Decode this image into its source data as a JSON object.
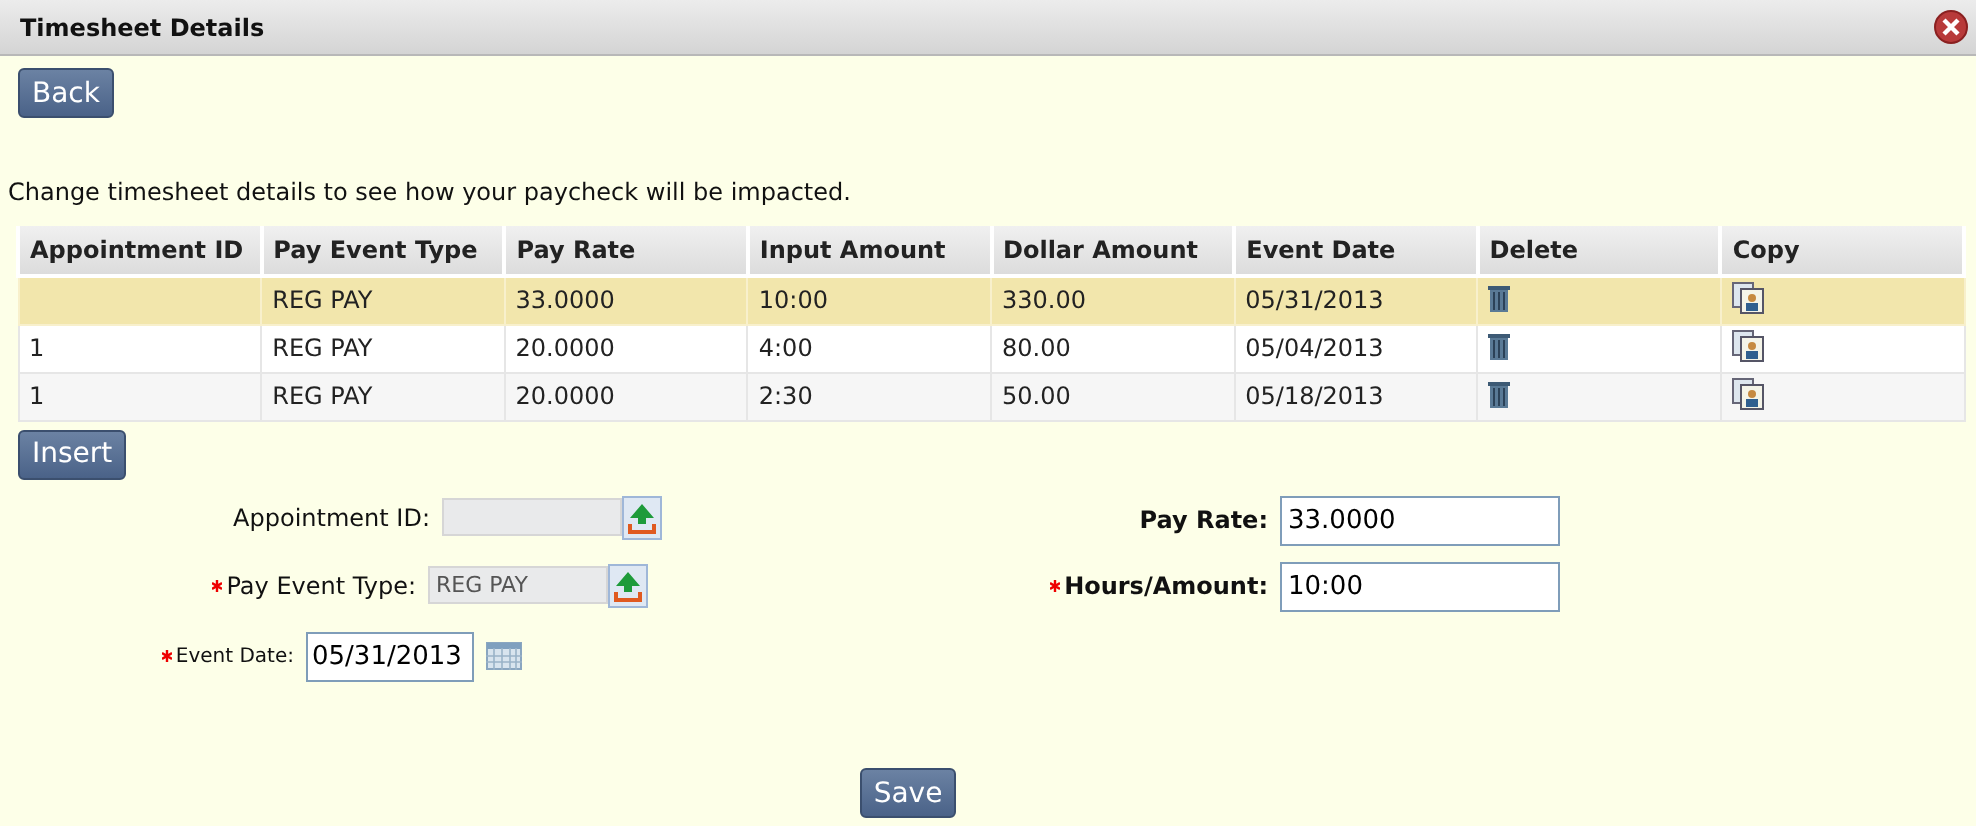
{
  "window": {
    "title": "Timesheet Details"
  },
  "back_button": "Back",
  "intro": "Change timesheet details to see how your paycheck will be impacted.",
  "table": {
    "columns": [
      "Appointment ID",
      "Pay Event Type",
      "Pay Rate",
      "Input Amount",
      "Dollar Amount",
      "Event Date",
      "Delete",
      "Copy"
    ],
    "rows": [
      {
        "selected": true,
        "cells": [
          null,
          "REG PAY",
          "33.0000",
          "10:00",
          "330.00",
          "05/31/2013"
        ]
      },
      {
        "selected": false,
        "cells": [
          "1",
          "REG PAY",
          "20.0000",
          "4:00",
          "80.00",
          "05/04/2013"
        ]
      },
      {
        "selected": false,
        "cells": [
          "1",
          "REG PAY",
          "20.0000",
          "2:30",
          "50.00",
          "05/18/2013"
        ]
      }
    ]
  },
  "insert_button": "Insert",
  "form": {
    "left": [
      {
        "kind": "lookup",
        "label": "Appointment ID:",
        "required": false
      },
      {
        "kind": "lookup",
        "label": "Pay Event Type:",
        "required": true,
        "value": "REG PAY"
      },
      {
        "kind": "date",
        "label": "Event Date:",
        "required": true,
        "value": "05/31/2013"
      }
    ],
    "right": [
      {
        "label": "Pay Rate:",
        "required": false,
        "value": "33.0000"
      },
      {
        "label": "Hours/Amount:",
        "required": true,
        "value": "10:00"
      }
    ]
  },
  "save_button": "Save"
}
